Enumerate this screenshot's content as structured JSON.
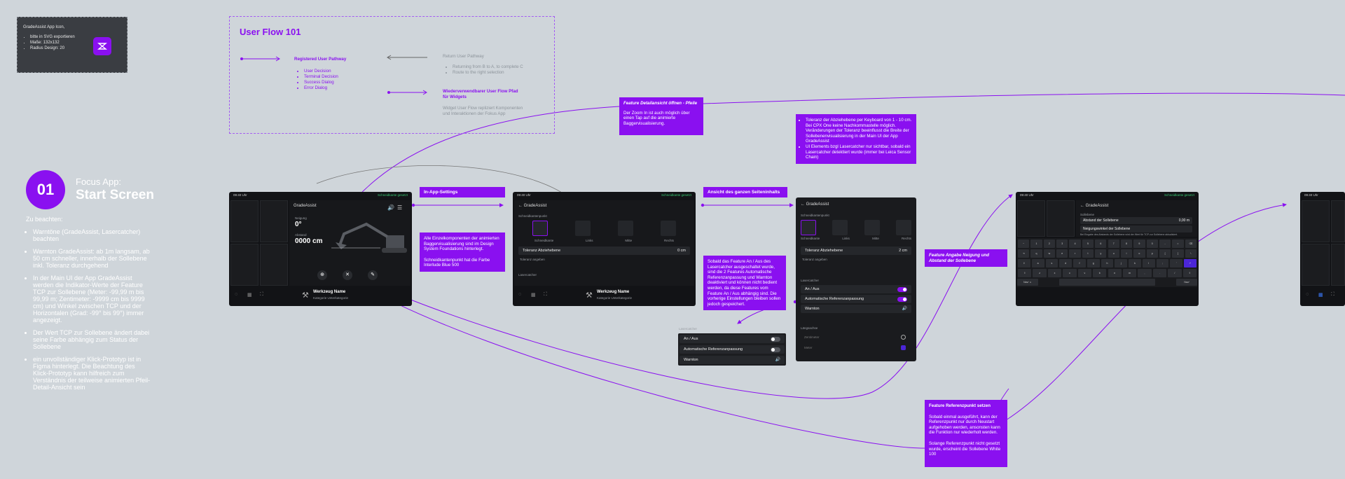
{
  "icon_note": {
    "title": "GradeAssist App Icon,",
    "items": [
      "bitte in SVG exportieren",
      "Maße: 132x132",
      "Radius Design: 20"
    ]
  },
  "user_flow": {
    "title": "User Flow 101",
    "registered": "Registered User Pathway",
    "registered_items": [
      "User Decision",
      "Terminal Decision",
      "Success Dialog",
      "Error Dialog"
    ],
    "return": "Return User Pathway",
    "return_items": [
      "Returning from B to A, to complete C",
      "Route to the right selection"
    ],
    "widgets_line1": "Wiederverwendbarer User Flow Pfad",
    "widgets_line2": "für Widgets",
    "widgets_sub1": "Widget User Flow repliziert Komponenten",
    "widgets_sub2": "und Interaktionen der Fokus App"
  },
  "intro": {
    "number": "01",
    "line1": "Focus App:",
    "line2": "Start Screen",
    "heading": "Zu beachten:",
    "bullets": [
      "Warntöne (GradeAssist, Lasercatcher) beachten",
      "Warnton GradeAssist: ab 1m langsam, ab 50 cm schneller, innerhalb der Sollebene inkl. Toleranz durchgehend",
      "In der Main UI der App GradeAssist werden die Indikator-Werte der Feature TCP zur Sollebene (Meter: -99,99 m bis 99,99 m; Zentimeter: -9999 cm bis 9999 cm) und Winkel zwischen TCP und der Horizontalen (Grad: -99° bis 99°) immer angezeigt.",
      "Der Wert TCP zur Sollebene ändert dabei seine Farbe abhängig zum Status der Sollebene",
      "ein unvollständiger Klick-Prototyp ist in Figma hinterlegt. Die Beachtung des Klick-Prototyp kann hilfreich zum Verständnis der teilweise animierten Pfeil-Detail-Ansicht sein"
    ]
  },
  "screen1": {
    "time": "09:40 Uhr",
    "status": "Schneidkante gesetzt",
    "app": "GradeAssist",
    "angle_label": "Neigung",
    "angle": "0°",
    "dist_label": "Abstand",
    "dist": "0000 cm",
    "tool_name": "Werkzeug Name",
    "tool_sub": "Kategorie  Unterkategorie"
  },
  "screen2": {
    "time": "09:40 Uhr",
    "status": "Schneidkante gesetzt",
    "back": "GradeAssist",
    "section1": "Schneidkantenpunkt",
    "options": [
      "Schneidkante",
      "Links",
      "Mitte",
      "Rechts"
    ],
    "tolerance": "Toleranz Abziehebene",
    "tolerance_value": "0 cm",
    "tolerance_hint": "Toleranz angeben",
    "section2": "Lasercatcher",
    "tool_name": "Werkzeug Name",
    "tool_sub": "Kategorie  Unterkategorie"
  },
  "screen3": {
    "back": "GradeAssist",
    "section1": "Schneidkantenpunkt",
    "options": [
      "Schneidkante",
      "Links",
      "Mitte",
      "Rechts"
    ],
    "tolerance": "Toleranz Abziehebene",
    "tolerance_value": "2 cm",
    "tolerance_hint": "Toleranz angeben",
    "section2": "Lasercatcher",
    "rows": [
      "An / Aus",
      "Automatische Referenzanpassung",
      "Warnton"
    ],
    "section3": "Längsachse",
    "radio": [
      "Zentimeter",
      "Meter"
    ]
  },
  "small_panel": {
    "title": "Lasercatcher",
    "rows": [
      "An / Aus",
      "Automatische Referenzanpassung",
      "Warnton"
    ]
  },
  "screen4": {
    "time": "09:40 Uhr",
    "status": "Schneidkante gesetzt",
    "back": "GradeAssist",
    "section": "Sollebene",
    "row1": "Abstand der Sollebene",
    "row1_value": "0,00 m",
    "row2": "Neigungswinkel der Sollebene",
    "hint": "Bei Eingabe des Abstands der Sollebene wird der Wert für TCP zur Sollebene aktualisiert.",
    "keys_row1": [
      "~",
      "1",
      "2",
      "3",
      "4",
      "5",
      "6",
      "7",
      "8",
      "9",
      "0",
      "-",
      "=",
      "⌫"
    ],
    "keys_row2": [
      "⇥",
      "q",
      "w",
      "e",
      "r",
      "t",
      "y",
      "u",
      "i",
      "o",
      "p",
      "[",
      "]",
      "\\"
    ],
    "keys_row3": [
      "⇪",
      "a",
      "s",
      "d",
      "f",
      "g",
      "h",
      "j",
      "k",
      "l",
      ";",
      "'",
      "↵"
    ],
    "keys_row4": [
      "⇧",
      "z",
      "x",
      "c",
      "v",
      "b",
      "n",
      "m",
      ",",
      ".",
      "/",
      "⇧"
    ],
    "key_left": "Nav/ ☺",
    "key_space": "",
    "key_right": "Nav/"
  },
  "screen5": {
    "time": "09:40 Uhr"
  },
  "annotations": {
    "in_app": "In-App-Settings",
    "komponenten": "Alle Einzelkomponenten der animierten Baggervisualisierung sind im Design System Foundations hinterlegt.",
    "schneid": "Schneidkantenpunkt hat die Farbe Interlude Blue 500",
    "feature_title": "Feature Detailansicht öffnen - Pfeile",
    "feature_body": "Der Zoom In ist auch möglich über einen Tap auf die animierte Baggervisualisierung.",
    "ansicht": "Ansicht des ganzen Seiteninhalts",
    "sobald": "Sobald das Feature An / Aus des Lasercatcher ausgeschaltet wurde, sind die 2 Features Automatische Referenzanpassung und Warnton deaktiviert und können nicht bedient werden, da diese Features vom Feature An / Aus abhängig sind. Die vorherige Einstellungen bleiben sollen jedoch gespeichert.",
    "toleranz_bullets": [
      "Toleranz der Abziehebene per Keyboard von 1 - 10 cm. Bei CPX One keine Nachkommastelle möglich. Veränderungen der Toleranz beeinflusst die Breite der Sollebenenvisualisierung in der Main UI der App GradeAssist",
      "UI Elements bzgl Lasercatcher nur sichtbar, sobald ein Lasercatcher detektiert wurde (immer bei Leica Sensor Chain)"
    ],
    "neigung": "Feature Angabe Neigung und Abstand der Sollebene",
    "ref_title": "Feature Referenzpunkt setzen",
    "ref_body1": "Sobald einmal ausgeführt, kann der Referenzpunkt nur durch Neustart aufgehoben werden, ansonsten kann die Funktion nur wiederholt werden.",
    "ref_body2": "Solange Referenzpunkt nicht gesetzt wurde, erscheint die Sollebene White 100"
  },
  "colors": {
    "accent": "#8a10f0",
    "background": "#cfd5da",
    "screen": "#121316",
    "ok": "#37c871"
  }
}
